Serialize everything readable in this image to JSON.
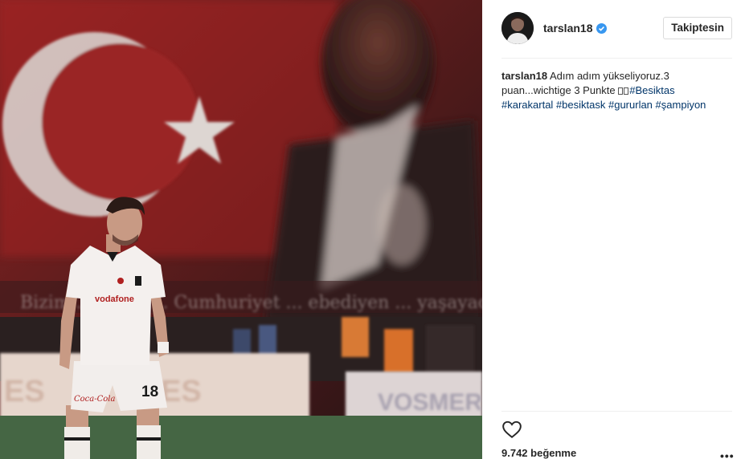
{
  "post": {
    "photo": {
      "banner_text": "Bizim ... ömrü ... Cumhuriyet ... ebediyen ... yaşayacaktır",
      "board_left": "ES",
      "board_mid": "ES",
      "board_right": "VOSMER C",
      "jersey_sponsor": "vodafone",
      "jersey_number": "18",
      "shorts_sponsor": "Coca-Cola"
    },
    "header": {
      "username": "tarslan18",
      "follow_label": "Takiptesin"
    },
    "caption": {
      "author": "tarslan18",
      "text": " Adım adım yükseliyoruz.3 puan...wichtige 3 Punkte ",
      "hashtags": [
        "#Besiktas",
        "#karakartal",
        "#besiktask",
        "#gururlan",
        "#şampiyon"
      ]
    },
    "likes": "9.742 beğenme",
    "more_label": "•••"
  },
  "icons": {
    "verified": "verified-badge-icon",
    "like": "heart-icon",
    "more": "more-options-icon"
  },
  "colors": {
    "hashtag": "#003569",
    "verified": "#3897f0",
    "flag_red": "#a81e1e"
  }
}
